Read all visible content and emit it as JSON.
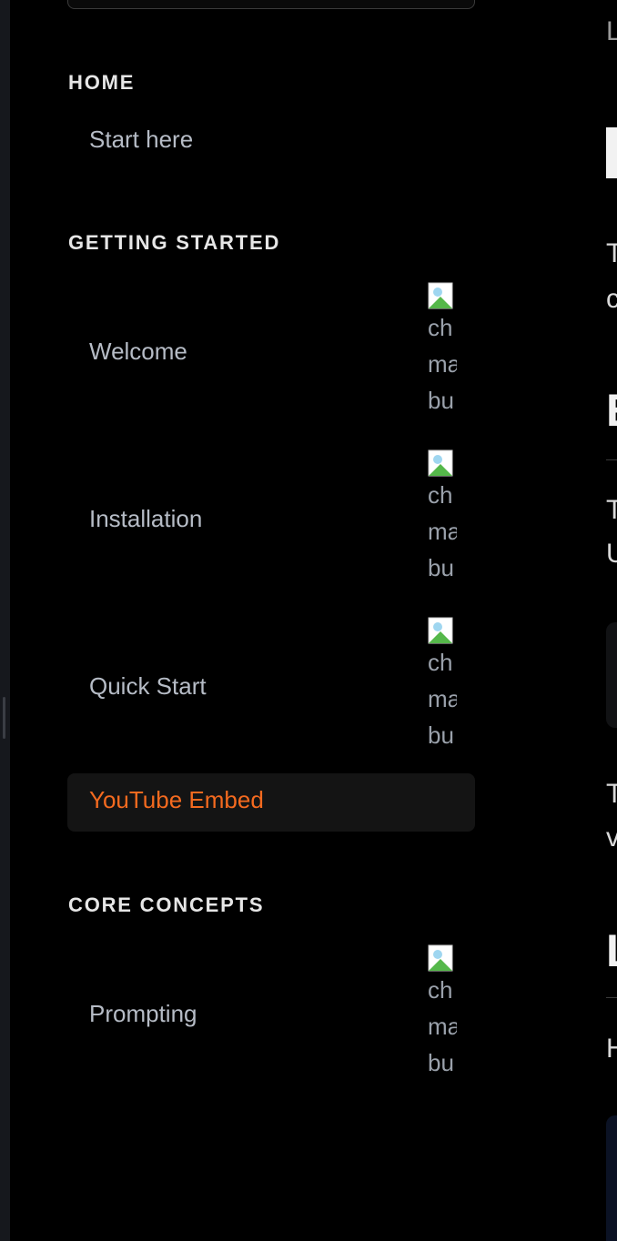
{
  "sidebar": {
    "sections": [
      {
        "title": "HOME",
        "items": [
          {
            "label": "Start here"
          }
        ]
      },
      {
        "title": "GETTING STARTED",
        "items": [
          {
            "label": "Welcome",
            "image_alt_fragment": "ch\nma\nbu"
          },
          {
            "label": "Installation",
            "image_alt_fragment": "ch\nma\nbu"
          },
          {
            "label": "Quick Start",
            "image_alt_fragment": "ch\nma\nbu"
          },
          {
            "label": "YouTube Embed",
            "active": true
          }
        ]
      },
      {
        "title": "CORE CONCEPTS",
        "items": [
          {
            "label": "Prompting",
            "image_alt_fragment": "ch\nma\nbu"
          }
        ]
      }
    ]
  },
  "main_fragments": {
    "breadcrumb_char": "L",
    "p1_line1": "T",
    "p1_line2": "c",
    "h2_1": "E",
    "p2_line1": "T",
    "p2_line2": "U",
    "p3_line1": "T",
    "p3_line2": "v",
    "h2_2": "L",
    "p4_line1": "H"
  },
  "colors": {
    "background": "#000000",
    "active_accent": "#f46a1f",
    "nav_text": "#b6bcc6",
    "section_title": "#e6e6e6"
  }
}
